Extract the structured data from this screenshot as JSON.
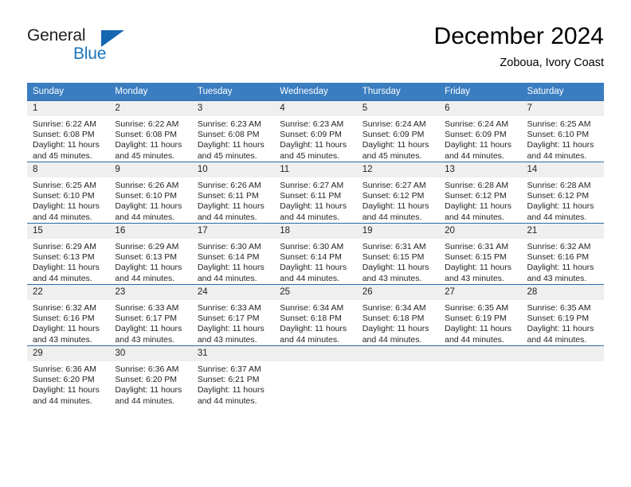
{
  "brand": {
    "word_one": "General",
    "word_two": "Blue",
    "triangle_color": "#1567b2",
    "blue_text_color": "#1b75bb"
  },
  "header": {
    "title": "December 2024",
    "subtitle": "Zoboua, Ivory Coast"
  },
  "colors": {
    "header_row_bg": "#3a7dc0",
    "week_divider": "#2c6aa8",
    "daynum_bg": "#efefef",
    "text": "#231f20"
  },
  "weekdays": [
    "Sunday",
    "Monday",
    "Tuesday",
    "Wednesday",
    "Thursday",
    "Friday",
    "Saturday"
  ],
  "weeks": [
    [
      {
        "day": "1",
        "sunrise": "Sunrise: 6:22 AM",
        "sunset": "Sunset: 6:08 PM",
        "daylight_1": "Daylight: 11 hours",
        "daylight_2": "and 45 minutes."
      },
      {
        "day": "2",
        "sunrise": "Sunrise: 6:22 AM",
        "sunset": "Sunset: 6:08 PM",
        "daylight_1": "Daylight: 11 hours",
        "daylight_2": "and 45 minutes."
      },
      {
        "day": "3",
        "sunrise": "Sunrise: 6:23 AM",
        "sunset": "Sunset: 6:08 PM",
        "daylight_1": "Daylight: 11 hours",
        "daylight_2": "and 45 minutes."
      },
      {
        "day": "4",
        "sunrise": "Sunrise: 6:23 AM",
        "sunset": "Sunset: 6:09 PM",
        "daylight_1": "Daylight: 11 hours",
        "daylight_2": "and 45 minutes."
      },
      {
        "day": "5",
        "sunrise": "Sunrise: 6:24 AM",
        "sunset": "Sunset: 6:09 PM",
        "daylight_1": "Daylight: 11 hours",
        "daylight_2": "and 45 minutes."
      },
      {
        "day": "6",
        "sunrise": "Sunrise: 6:24 AM",
        "sunset": "Sunset: 6:09 PM",
        "daylight_1": "Daylight: 11 hours",
        "daylight_2": "and 44 minutes."
      },
      {
        "day": "7",
        "sunrise": "Sunrise: 6:25 AM",
        "sunset": "Sunset: 6:10 PM",
        "daylight_1": "Daylight: 11 hours",
        "daylight_2": "and 44 minutes."
      }
    ],
    [
      {
        "day": "8",
        "sunrise": "Sunrise: 6:25 AM",
        "sunset": "Sunset: 6:10 PM",
        "daylight_1": "Daylight: 11 hours",
        "daylight_2": "and 44 minutes."
      },
      {
        "day": "9",
        "sunrise": "Sunrise: 6:26 AM",
        "sunset": "Sunset: 6:10 PM",
        "daylight_1": "Daylight: 11 hours",
        "daylight_2": "and 44 minutes."
      },
      {
        "day": "10",
        "sunrise": "Sunrise: 6:26 AM",
        "sunset": "Sunset: 6:11 PM",
        "daylight_1": "Daylight: 11 hours",
        "daylight_2": "and 44 minutes."
      },
      {
        "day": "11",
        "sunrise": "Sunrise: 6:27 AM",
        "sunset": "Sunset: 6:11 PM",
        "daylight_1": "Daylight: 11 hours",
        "daylight_2": "and 44 minutes."
      },
      {
        "day": "12",
        "sunrise": "Sunrise: 6:27 AM",
        "sunset": "Sunset: 6:12 PM",
        "daylight_1": "Daylight: 11 hours",
        "daylight_2": "and 44 minutes."
      },
      {
        "day": "13",
        "sunrise": "Sunrise: 6:28 AM",
        "sunset": "Sunset: 6:12 PM",
        "daylight_1": "Daylight: 11 hours",
        "daylight_2": "and 44 minutes."
      },
      {
        "day": "14",
        "sunrise": "Sunrise: 6:28 AM",
        "sunset": "Sunset: 6:12 PM",
        "daylight_1": "Daylight: 11 hours",
        "daylight_2": "and 44 minutes."
      }
    ],
    [
      {
        "day": "15",
        "sunrise": "Sunrise: 6:29 AM",
        "sunset": "Sunset: 6:13 PM",
        "daylight_1": "Daylight: 11 hours",
        "daylight_2": "and 44 minutes."
      },
      {
        "day": "16",
        "sunrise": "Sunrise: 6:29 AM",
        "sunset": "Sunset: 6:13 PM",
        "daylight_1": "Daylight: 11 hours",
        "daylight_2": "and 44 minutes."
      },
      {
        "day": "17",
        "sunrise": "Sunrise: 6:30 AM",
        "sunset": "Sunset: 6:14 PM",
        "daylight_1": "Daylight: 11 hours",
        "daylight_2": "and 44 minutes."
      },
      {
        "day": "18",
        "sunrise": "Sunrise: 6:30 AM",
        "sunset": "Sunset: 6:14 PM",
        "daylight_1": "Daylight: 11 hours",
        "daylight_2": "and 44 minutes."
      },
      {
        "day": "19",
        "sunrise": "Sunrise: 6:31 AM",
        "sunset": "Sunset: 6:15 PM",
        "daylight_1": "Daylight: 11 hours",
        "daylight_2": "and 43 minutes."
      },
      {
        "day": "20",
        "sunrise": "Sunrise: 6:31 AM",
        "sunset": "Sunset: 6:15 PM",
        "daylight_1": "Daylight: 11 hours",
        "daylight_2": "and 43 minutes."
      },
      {
        "day": "21",
        "sunrise": "Sunrise: 6:32 AM",
        "sunset": "Sunset: 6:16 PM",
        "daylight_1": "Daylight: 11 hours",
        "daylight_2": "and 43 minutes."
      }
    ],
    [
      {
        "day": "22",
        "sunrise": "Sunrise: 6:32 AM",
        "sunset": "Sunset: 6:16 PM",
        "daylight_1": "Daylight: 11 hours",
        "daylight_2": "and 43 minutes."
      },
      {
        "day": "23",
        "sunrise": "Sunrise: 6:33 AM",
        "sunset": "Sunset: 6:17 PM",
        "daylight_1": "Daylight: 11 hours",
        "daylight_2": "and 43 minutes."
      },
      {
        "day": "24",
        "sunrise": "Sunrise: 6:33 AM",
        "sunset": "Sunset: 6:17 PM",
        "daylight_1": "Daylight: 11 hours",
        "daylight_2": "and 43 minutes."
      },
      {
        "day": "25",
        "sunrise": "Sunrise: 6:34 AM",
        "sunset": "Sunset: 6:18 PM",
        "daylight_1": "Daylight: 11 hours",
        "daylight_2": "and 44 minutes."
      },
      {
        "day": "26",
        "sunrise": "Sunrise: 6:34 AM",
        "sunset": "Sunset: 6:18 PM",
        "daylight_1": "Daylight: 11 hours",
        "daylight_2": "and 44 minutes."
      },
      {
        "day": "27",
        "sunrise": "Sunrise: 6:35 AM",
        "sunset": "Sunset: 6:19 PM",
        "daylight_1": "Daylight: 11 hours",
        "daylight_2": "and 44 minutes."
      },
      {
        "day": "28",
        "sunrise": "Sunrise: 6:35 AM",
        "sunset": "Sunset: 6:19 PM",
        "daylight_1": "Daylight: 11 hours",
        "daylight_2": "and 44 minutes."
      }
    ],
    [
      {
        "day": "29",
        "sunrise": "Sunrise: 6:36 AM",
        "sunset": "Sunset: 6:20 PM",
        "daylight_1": "Daylight: 11 hours",
        "daylight_2": "and 44 minutes."
      },
      {
        "day": "30",
        "sunrise": "Sunrise: 6:36 AM",
        "sunset": "Sunset: 6:20 PM",
        "daylight_1": "Daylight: 11 hours",
        "daylight_2": "and 44 minutes."
      },
      {
        "day": "31",
        "sunrise": "Sunrise: 6:37 AM",
        "sunset": "Sunset: 6:21 PM",
        "daylight_1": "Daylight: 11 hours",
        "daylight_2": "and 44 minutes."
      },
      {
        "day": "",
        "sunrise": "",
        "sunset": "",
        "daylight_1": "",
        "daylight_2": ""
      },
      {
        "day": "",
        "sunrise": "",
        "sunset": "",
        "daylight_1": "",
        "daylight_2": ""
      },
      {
        "day": "",
        "sunrise": "",
        "sunset": "",
        "daylight_1": "",
        "daylight_2": ""
      },
      {
        "day": "",
        "sunrise": "",
        "sunset": "",
        "daylight_1": "",
        "daylight_2": ""
      }
    ]
  ]
}
